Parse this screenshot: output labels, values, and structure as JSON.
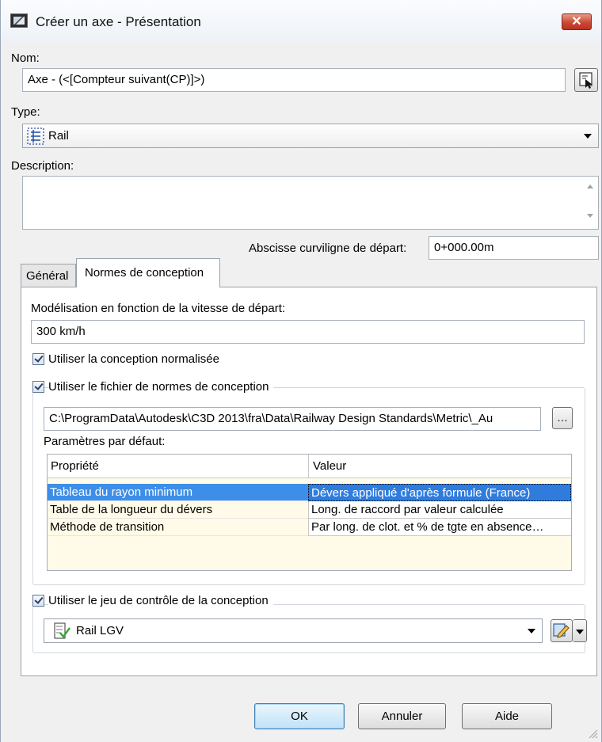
{
  "window": {
    "title": "Créer un axe - Présentation",
    "close_glyph": "✕"
  },
  "name": {
    "label": "Nom:",
    "value": "Axe - (<[Compteur suivant(CP)]>)"
  },
  "type": {
    "label": "Type:",
    "value": "Rail"
  },
  "description": {
    "label": "Description:",
    "value": ""
  },
  "station": {
    "label": "Abscisse curviligne de départ:",
    "value": "0+000.00m"
  },
  "tabs": [
    {
      "label": "Général"
    },
    {
      "label": "Normes de conception"
    }
  ],
  "design": {
    "speed_label": "Modélisation en fonction de la vitesse de départ:",
    "speed_value": "300 km/h",
    "use_criteria_label": "Utiliser la conception normalisée",
    "use_criteria_checked": true,
    "use_file_label": "Utiliser le fichier de normes de conception",
    "use_file_checked": true,
    "file_path": "C:\\ProgramData\\Autodesk\\C3D 2013\\fra\\Data\\Railway Design Standards\\Metric\\_Au",
    "browse_glyph": "…",
    "defaults_label": "Paramètres par défaut:",
    "check_set_label": "Utiliser le jeu de contrôle de la conception",
    "check_set_checked": true,
    "check_set_value": "Rail LGV"
  },
  "table": {
    "headers": [
      "Propriété",
      "Valeur"
    ],
    "rows": [
      {
        "property": "Tableau du rayon minimum",
        "value": "Dévers appliqué d'après formule (France)",
        "selected": true
      },
      {
        "property": "Table de la longueur du dévers",
        "value": "Long. de raccord par valeur calculée",
        "selected": false
      },
      {
        "property": "Méthode de transition",
        "value": "Par long. de clot. et % de tgte en absence…",
        "selected": false
      }
    ]
  },
  "buttons": {
    "ok": "OK",
    "cancel": "Annuler",
    "help": "Aide"
  },
  "colors": {
    "selection": "#3d8ee9",
    "grid_background": "#fffbe8",
    "close_button": "#c94a36"
  }
}
